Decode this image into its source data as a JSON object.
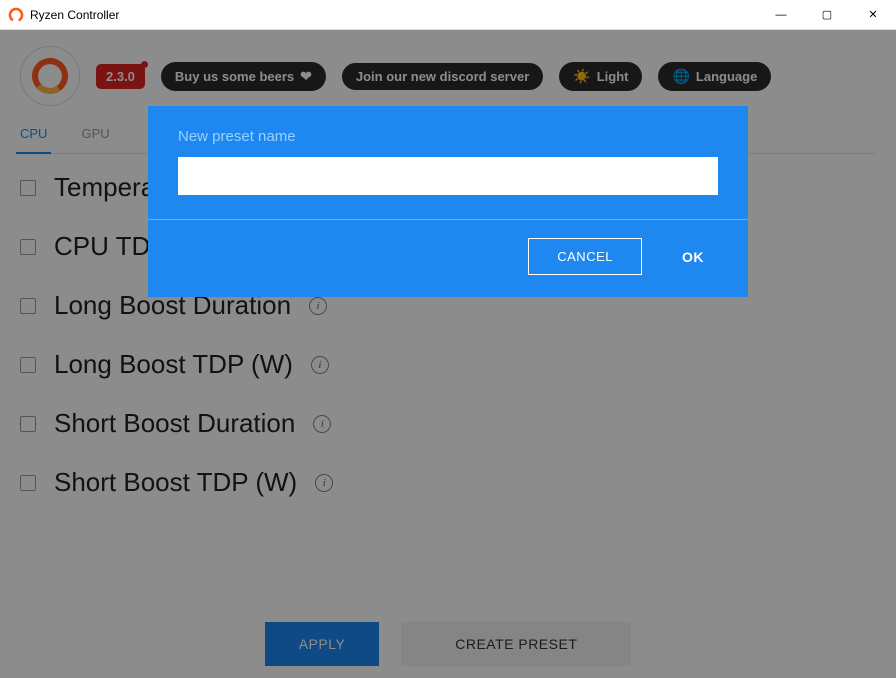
{
  "window": {
    "title": "Ryzen Controller",
    "minimize": "—",
    "maximize": "▢",
    "close": "✕"
  },
  "header": {
    "version": "2.3.0",
    "beers": "Buy us some beers",
    "discord": "Join our new discord server",
    "light": "Light",
    "language": "Language"
  },
  "tabs": {
    "cpu": "CPU",
    "gpu": "GPU"
  },
  "settings": [
    {
      "label": "Temperature Limit (°C)"
    },
    {
      "label": "CPU TDP (W)"
    },
    {
      "label": "Long Boost Duration"
    },
    {
      "label": "Long Boost TDP (W)"
    },
    {
      "label": "Short Boost Duration"
    },
    {
      "label": "Short Boost TDP (W)"
    }
  ],
  "footer": {
    "apply": "APPLY",
    "create_preset": "CREATE PRESET"
  },
  "modal": {
    "label": "New preset name",
    "input_value": "",
    "cancel": "CANCEL",
    "ok": "OK"
  }
}
